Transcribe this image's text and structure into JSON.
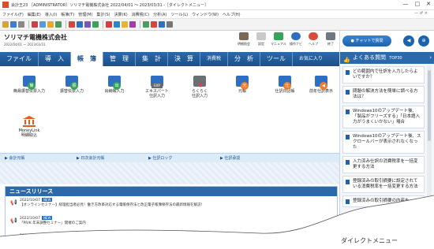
{
  "titlebar": {
    "text": "会計王23 ［ADMINISTRATOR］ソリマチ電機株式会社 2022/04/01 〜 2023/03/31 -［ダイレクトメニュー］"
  },
  "window_buttons": [
    "—",
    "□",
    "✕"
  ],
  "menubar": {
    "items": [
      "ファイル(F)",
      "編集(E)",
      "導入(I)",
      "帳簿(T)",
      "管理(M)",
      "集計(S)",
      "決算(K)",
      "消費税(C)",
      "分析(A)",
      "ツール(L)",
      "ウィンドウ(W)",
      "ヘルプ(H)"
    ],
    "right": "— ♂ ×"
  },
  "company": {
    "name": "ソリマチ電機株式会社",
    "period": "2022/04/01 〜 2023/03/31"
  },
  "tools": [
    {
      "label": "明細照会",
      "icon": "building-icon",
      "color": "#7a6a55"
    },
    {
      "label": "設定",
      "icon": "gear-icon",
      "color": "#c9c9c9"
    },
    {
      "label": "マニュアル",
      "icon": "manual-icon",
      "color": "#3aa35b"
    },
    {
      "label": "操作ナビ",
      "icon": "navi-icon",
      "color": "#2e6fc4"
    },
    {
      "label": "ヘルプ",
      "icon": "lifebuoy-icon",
      "color": "#d84a3a"
    },
    {
      "label": "終了",
      "icon": "exit-icon",
      "color": "#6f7780"
    }
  ],
  "tabs": [
    {
      "label": "ファイル",
      "active": false
    },
    {
      "label": "導　入",
      "active": false
    },
    {
      "label": "帳　簿",
      "active": true
    },
    {
      "label": "管　理",
      "active": false
    },
    {
      "label": "集　計",
      "active": false
    },
    {
      "label": "決　算",
      "active": false
    },
    {
      "label": "消費税",
      "active": false
    },
    {
      "label": "分　析",
      "active": false
    },
    {
      "label": "ツール",
      "active": false
    },
    {
      "label": "お気に入り",
      "active": false
    }
  ],
  "menu_items": [
    {
      "label": "簡易振替伝票入力",
      "badge": "簡",
      "badge_color": "#3aa35b"
    },
    {
      "label": "振替伝票入力",
      "badge": "振",
      "badge_color": "#3aa35b"
    },
    {
      "label": "出納帳入力",
      "badge": "出",
      "badge_color": "#3aa35b"
    },
    {
      "label": "エキスパート\n仕訳入力",
      "badge": "EXP",
      "badge_color": "#6b6b6b"
    },
    {
      "label": "らくらく\n仕訳入力",
      "badge": "♥",
      "badge_color": "#d8454a"
    },
    {
      "label": "元帳",
      "badge": "元",
      "badge_color": "#ef7d2a"
    },
    {
      "label": "仕訳日記帳",
      "badge": "仕",
      "badge_color": "#ef7d2a"
    },
    {
      "label": "前年仕訳表示",
      "badge": "◀",
      "badge_color": "#ef7d2a"
    },
    {
      "label": "MoneyLink\n明細取込",
      "badge": "",
      "badge_color": "#e45a1e"
    }
  ],
  "shortcuts": [
    "▶ 会計元帳",
    "▶ 日次会計元帳",
    "▶ 仕訳ロック",
    "▶ 仕訳承認"
  ],
  "news": {
    "title": "ニュースリリース",
    "new_badge": "NEW",
    "items": [
      {
        "date": "2022/10/07",
        "text": "【オンラインセミナー】経理担当者必見！働き方改革対応する電帳保存法と改正電子帳簿保存法の最新情報を解説！"
      },
      {
        "date": "2022/10/07",
        "text": "「PR/K 年末調整セミナー」開催のご案内"
      },
      {
        "date": "2022/09/30",
        "text": "ソリマチ会計にまつわるサービス、機能改善等の新情報を公開しています"
      }
    ]
  },
  "chat": {
    "label": "チャットで質問",
    "buttons": [
      "◀",
      "⊕"
    ]
  },
  "faq": {
    "title": "よくある質問",
    "badge": "TOP30",
    "items": [
      "どの範囲内で仕訳を入力したらよいですか？",
      "問題の解決方法を簡単に調べる方法は？",
      "Windows10のアップデート後、「製品がフリーズする」「日本語入力がうまくいかない」場合",
      "Windows10のアップデート後、スクロールバーが表示されなくなった",
      "入力済み仕訳の消費税率を一括変更する方法",
      "登録済みの取引摘要に設定されている消費税率を一括変更する方法",
      "登録済みの取引摘要の内容を"
    ]
  },
  "caption": "ダイレクトメニュー"
}
